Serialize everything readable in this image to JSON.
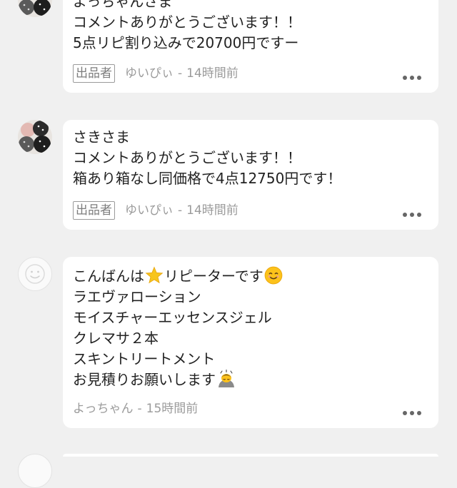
{
  "comments": [
    {
      "lines": [
        "よっちゃんさま",
        "コメントありがとうございます！！",
        "5点リピ割り込みで20700円ですー"
      ],
      "badge": "出品者",
      "author": "ゆいぴぃ",
      "separator": "-",
      "time": "14時間前",
      "avatar_icon": "dotted-pattern-avatar",
      "more_icon": "more-dots-icon"
    },
    {
      "lines": [
        "さきさま",
        "コメントありがとうございます！！",
        "箱あり箱なし同価格で4点12750円です！"
      ],
      "badge": "出品者",
      "author": "ゆいぴぃ",
      "separator": "-",
      "time": "14時間前",
      "avatar_icon": "dotted-pattern-avatar",
      "more_icon": "more-dots-icon"
    },
    {
      "line1_pre": "こんばんは",
      "line1_post": "リピーターです",
      "emoji_star": "star-emoji",
      "emoji_smile": "smiling-face-emoji",
      "lines": [
        "ラエヴァローション",
        "モイスチャーエッセンスジェル",
        "クレマサ２本",
        "スキントリートメント"
      ],
      "last_line": "お見積りお願いします",
      "emoji_bow": "bowing-person-emoji",
      "author": "よっちゃん",
      "separator": "-",
      "time": "15時間前",
      "avatar_icon": "default-face-avatar",
      "more_icon": "more-dots-icon"
    }
  ],
  "colors": {
    "background": "#f0f0f0",
    "bubble": "#ffffff",
    "text": "#222222",
    "meta": "#9b9b9b"
  }
}
